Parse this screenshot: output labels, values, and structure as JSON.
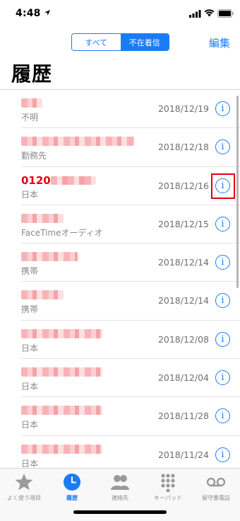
{
  "status_bar": {
    "time": "4:48"
  },
  "header": {
    "segments": [
      "すべて",
      "不在着信"
    ],
    "selected_segment": "不在着信",
    "edit_label": "編集",
    "title": "履歴"
  },
  "colors": {
    "accent": "#1a7cf5",
    "highlight": "#e60012",
    "missed_number": "#e60012"
  },
  "calls": [
    {
      "label": "不明",
      "date": "2018/12/19",
      "info_icon": "info-icon"
    },
    {
      "label": "勤務先",
      "date": "2018/12/18",
      "info_icon": "info-icon"
    },
    {
      "number_prefix": "0120",
      "label": "日本",
      "date": "2018/12/16",
      "info_icon": "info-icon",
      "highlighted": true
    },
    {
      "label": "FaceTimeオーディオ",
      "date": "2018/12/15",
      "info_icon": "info-icon"
    },
    {
      "label": "携帯",
      "date": "2018/12/14",
      "info_icon": "info-icon"
    },
    {
      "label": "携帯",
      "date": "2018/12/14",
      "info_icon": "info-icon"
    },
    {
      "label": "日本",
      "date": "2018/12/08",
      "info_icon": "info-icon"
    },
    {
      "label": "日本",
      "date": "2018/12/04",
      "info_icon": "info-icon"
    },
    {
      "label": "日本",
      "date": "2018/11/28",
      "info_icon": "info-icon"
    },
    {
      "label": "日本",
      "date": "2018/11/24",
      "info_icon": "info-icon"
    }
  ],
  "info_glyph": "i",
  "tabbar": {
    "tabs": [
      {
        "label": "よく使う項目",
        "icon": "star-icon"
      },
      {
        "label": "履歴",
        "icon": "clock-icon",
        "active": true
      },
      {
        "label": "連絡先",
        "icon": "contacts-icon"
      },
      {
        "label": "キーパッド",
        "icon": "keypad-icon"
      },
      {
        "label": "留守番電話",
        "icon": "voicemail-icon"
      }
    ]
  }
}
